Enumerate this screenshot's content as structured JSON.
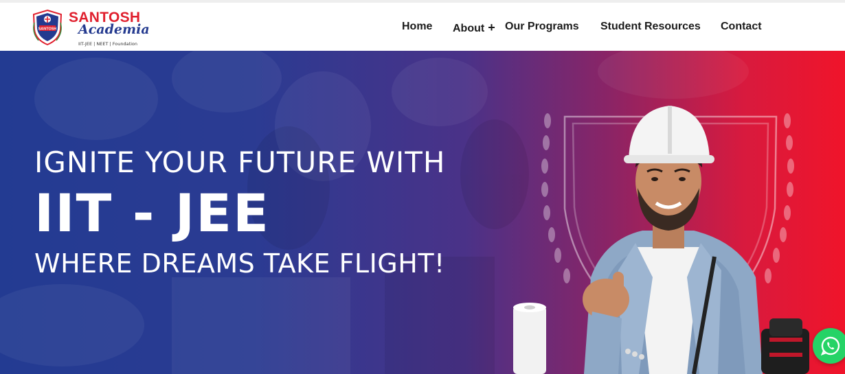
{
  "logo": {
    "title": "SANTOSH",
    "subtitle": "Academia",
    "tagline": "IIT-JEE | NEET | Foundation",
    "emblem_text": "SANTOSH"
  },
  "nav": {
    "items": [
      {
        "label": "Home"
      },
      {
        "label": "About"
      },
      {
        "label": "Our Programs"
      },
      {
        "label": "Student Resources"
      },
      {
        "label": "Contact"
      }
    ],
    "about_expand_symbol": "+"
  },
  "hero": {
    "line1": "IGNITE YOUR FUTURE WITH",
    "line2": "IIT - JEE",
    "line3": "WHERE DREAMS TAKE FLIGHT!"
  },
  "colors": {
    "brand_red": "#e0202e",
    "brand_blue": "#243a8f",
    "hero_left": "#233b92",
    "hero_right": "#f0142a",
    "whatsapp_green": "#25d366"
  },
  "icons": [
    "logo-emblem-icon",
    "whatsapp-icon"
  ]
}
